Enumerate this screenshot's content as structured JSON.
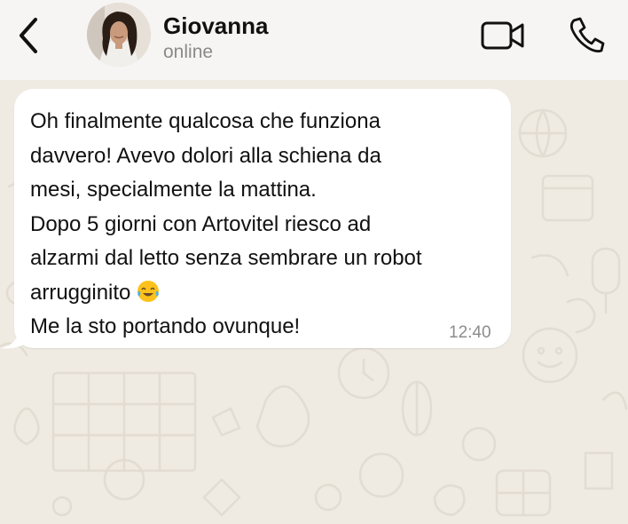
{
  "header": {
    "contact_name": "Giovanna",
    "status": "online",
    "icons": [
      "back-chevron-icon",
      "avatar-photo",
      "video-call-icon",
      "phone-icon"
    ]
  },
  "message": {
    "lines": [
      "Oh finalmente qualcosa che funziona",
      "davvero! Avevo dolori alla schiena da",
      "mesi, specialmente la mattina.",
      "Dopo 5 giorni con Artovitel riesco ad",
      "alzarmi dal letto senza sembrare un robot",
      "arrugginito",
      "Me la sto portando ovunque!"
    ],
    "emoji": "face-with-tears-of-joy-icon",
    "time": "12:40"
  },
  "colors": {
    "header_bg": "#f6f5f3",
    "chat_bg": "#efeae2",
    "bubble_bg": "#ffffff",
    "muted_text": "#8a8a8a"
  }
}
